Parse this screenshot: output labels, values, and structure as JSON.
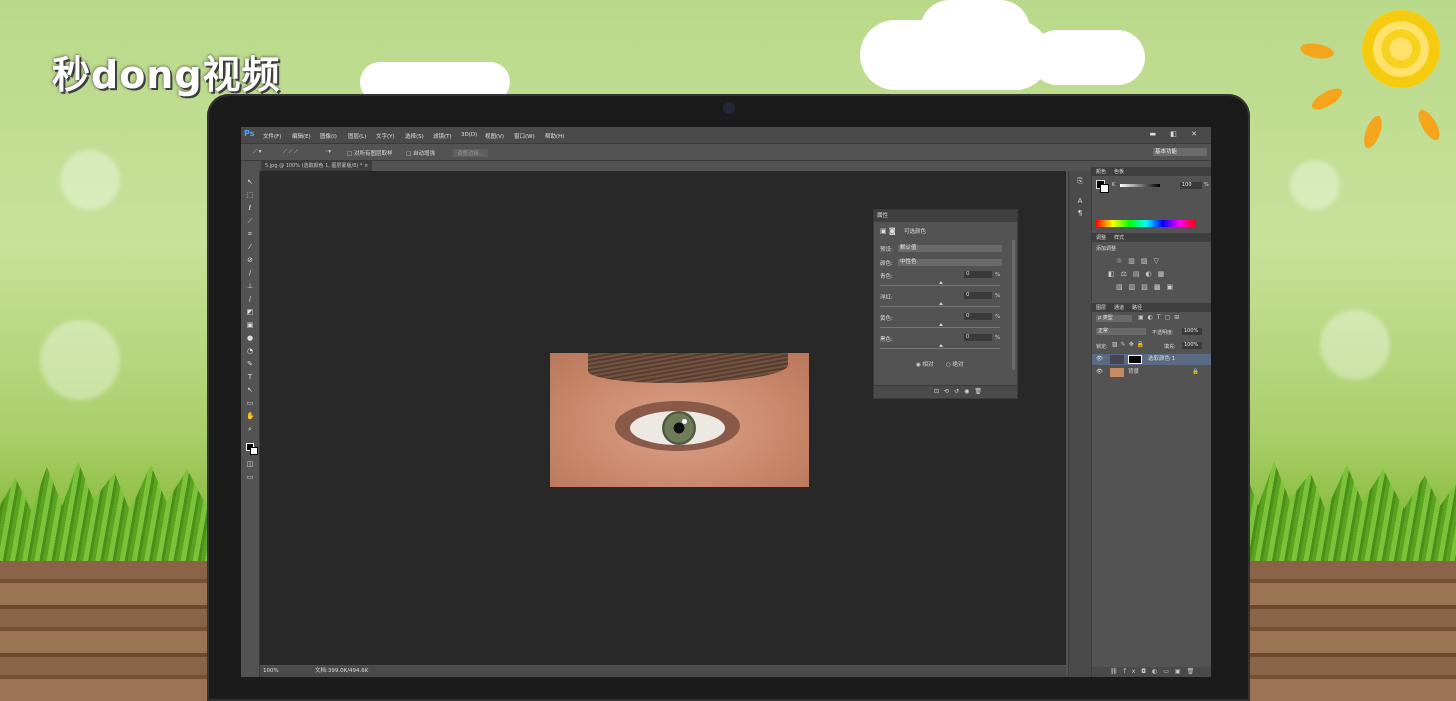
{
  "brand": {
    "logo_text": "秒dong视频"
  },
  "menubar": {
    "app_icon": "Ps",
    "items": [
      "文件(F)",
      "编辑(E)",
      "图像(I)",
      "图层(L)",
      "文字(Y)",
      "选择(S)",
      "滤镜(T)",
      "3D(D)",
      "视图(V)",
      "窗口(W)",
      "帮助(H)"
    ],
    "window_buttons": "▬ ◧ ✕"
  },
  "options": {
    "sample_all_layers": "□ 对所有图层取样",
    "auto_enhance": "□ 自动增强",
    "refine_edge": "调整边缘...",
    "workspace": "基本功能"
  },
  "document": {
    "tab_label": "5.jpg @ 100% (选取颜色 1, 图层蒙版/8) * ×"
  },
  "status": {
    "zoom": "100%",
    "doc_info": "文档:399.0K/494.6K"
  },
  "properties": {
    "header": "属性",
    "title": "可选颜色",
    "preset_label": "预设:",
    "preset_value": "默认值",
    "colors_label": "颜色:",
    "colors_value": "中性色",
    "sliders": [
      {
        "label": "青色:",
        "value": "0",
        "unit": "%"
      },
      {
        "label": "洋红:",
        "value": "0",
        "unit": "%"
      },
      {
        "label": "黄色:",
        "value": "0",
        "unit": "%"
      },
      {
        "label": "黑色:",
        "value": "0",
        "unit": "%"
      }
    ],
    "radio_relative": "◉ 相对",
    "radio_absolute": "○ 绝对"
  },
  "color_panel": {
    "tabs": [
      "颜色",
      "色板"
    ],
    "k_label": "K",
    "k_value": "100",
    "k_unit": "%"
  },
  "adjust_panel": {
    "tabs": [
      "调整",
      "样式"
    ],
    "title": "添加调整"
  },
  "layers_panel": {
    "tabs": [
      "图层",
      "通道",
      "路径"
    ],
    "filter": "ρ 类型",
    "blend_mode": "正常",
    "opacity_label": "不透明度:",
    "opacity_value": "100%",
    "lock_label": "锁定:",
    "fill_label": "填充:",
    "fill_value": "100%",
    "layers": [
      {
        "name": "选取颜色 1",
        "selected": true
      },
      {
        "name": "背景",
        "selected": false
      }
    ]
  },
  "colors": {
    "accent": "#5c6b85",
    "canvas": "#282828"
  }
}
